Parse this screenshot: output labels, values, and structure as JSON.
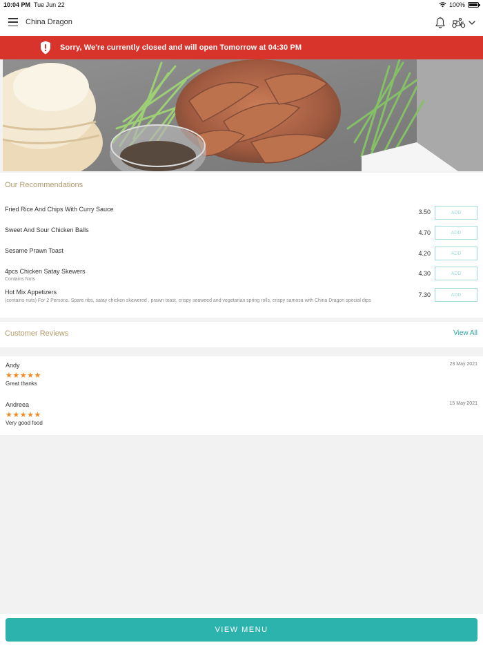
{
  "status_bar": {
    "time": "10:04 PM",
    "date": "Tue Jun 22",
    "battery": "100%"
  },
  "header": {
    "title": "China Dragon",
    "icons": [
      "menu-icon",
      "bell-icon",
      "delivery-scooter-icon",
      "chevron-down-icon"
    ]
  },
  "banner": {
    "text": "Sorry, We're currently closed and will open Tomorrow at 04:30 PM",
    "color": "#d9342b"
  },
  "recommendations": {
    "title": "Our Recommendations",
    "items": [
      {
        "name": "Fried Rice And Chips With Curry Sauce",
        "description": "",
        "price": "3.50",
        "add_label": "ADD"
      },
      {
        "name": "Sweet And Sour Chicken Balls",
        "description": "",
        "price": "4.70",
        "add_label": "ADD"
      },
      {
        "name": "Sesame Prawn Toast",
        "description": "",
        "price": "4.20",
        "add_label": "ADD"
      },
      {
        "name": "4pcs Chicken Satay Skewers",
        "description": "Contains Nuts",
        "price": "4.30",
        "add_label": "ADD"
      },
      {
        "name": "Hot Mix Appetizers",
        "description": "(contains nuts) For 2 Persons. Spare ribs, satay chicken skewered , prawn toast, crispy seaweed and vegetarian spring rolls, crispy samosa with China Dragon special dips",
        "price": "7.30",
        "add_label": "ADD"
      }
    ]
  },
  "reviews": {
    "title": "Customer Reviews",
    "view_all_label": "View All",
    "items": [
      {
        "name": "Andy",
        "date": "23 May 2021",
        "stars": "★★★★★",
        "rating": 5,
        "text": "Great thanks"
      },
      {
        "name": "Andreea",
        "date": "15 May 2021",
        "stars": "★★★★★",
        "rating": 5,
        "text": "Very good food"
      }
    ]
  },
  "footer": {
    "button_label": "VIEW MENU",
    "accent": "#2db3ae"
  }
}
